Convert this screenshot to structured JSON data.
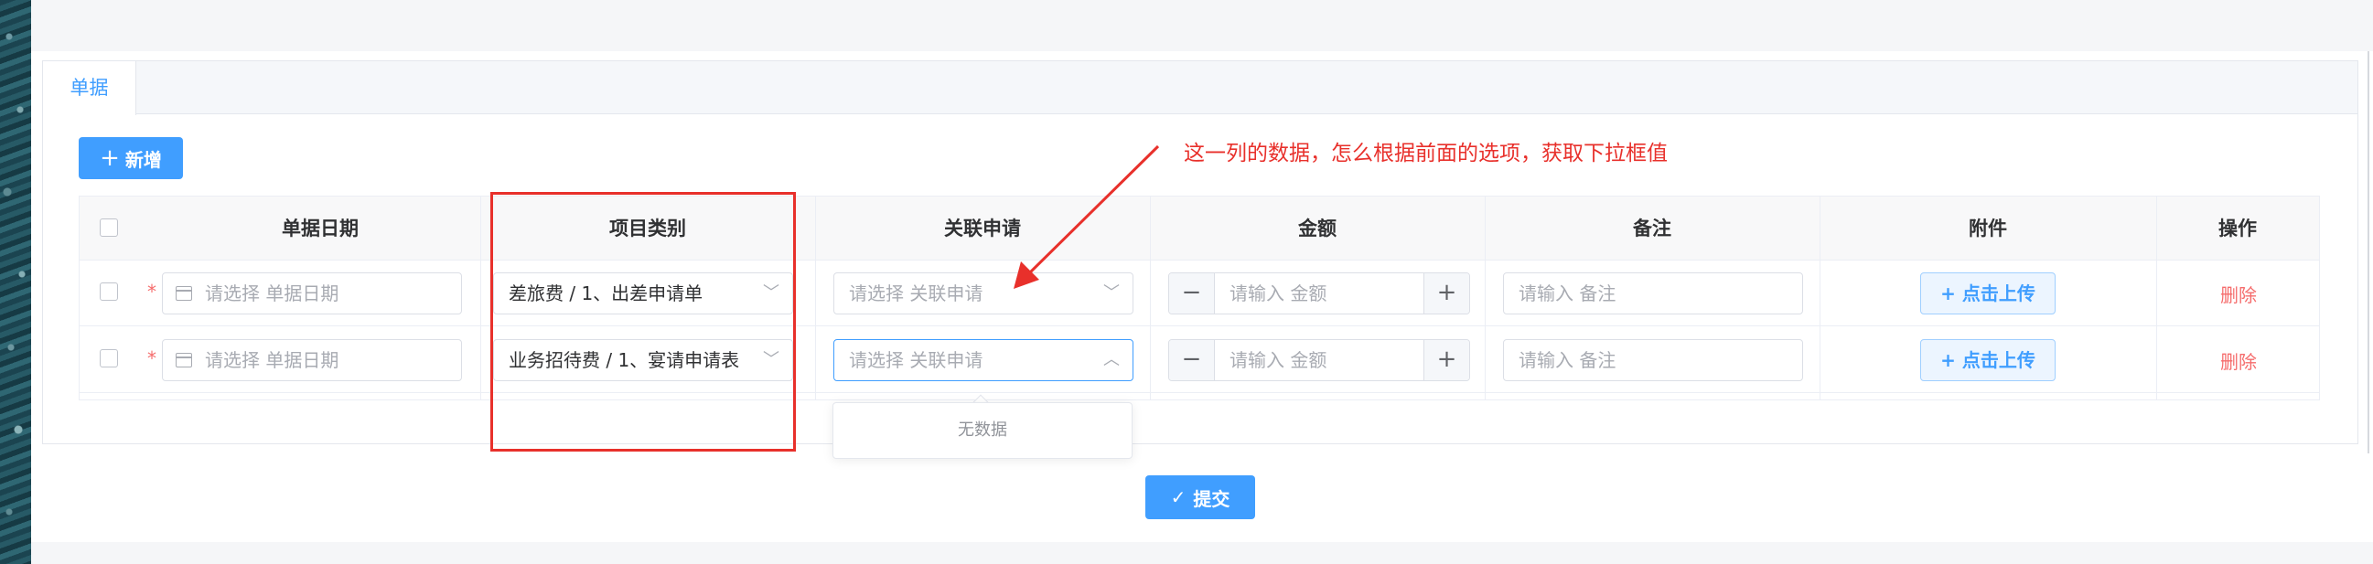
{
  "tabs": [
    {
      "label": "单据",
      "active": true
    }
  ],
  "toolbar": {
    "add_icon": "+",
    "add_label": "新增"
  },
  "table": {
    "columns": [
      "单据日期",
      "项目类别",
      "关联申请",
      "金额",
      "备注",
      "附件",
      "操作"
    ],
    "rows": [
      {
        "date_placeholder": "请选择 单据日期",
        "category": "差旅费 / 1、出差申请单",
        "related_placeholder": "请选择 关联申请",
        "amount_placeholder": "请输入 金额",
        "remark_placeholder": "请输入 备注",
        "upload_label": "+ 点击上传",
        "delete_label": "删除"
      },
      {
        "date_placeholder": "请选择 单据日期",
        "category": "业务招待费 / 1、宴请申请表",
        "related_placeholder": "请选择 关联申请",
        "amount_placeholder": "请输入 金额",
        "remark_placeholder": "请输入 备注",
        "upload_label": "+ 点击上传",
        "delete_label": "删除"
      }
    ]
  },
  "required_mark": "*",
  "stepper": {
    "minus": "−",
    "plus": "+"
  },
  "chevrons": {
    "down": "﹀",
    "up": "︿"
  },
  "dropdown": {
    "empty_text": "无数据"
  },
  "annotation": {
    "text": "这一列的数据，怎么根据前面的选项，获取下拉框值",
    "color": "#e8302b"
  },
  "submit": {
    "icon": "✓",
    "label": "提交"
  },
  "colors": {
    "primary": "#409eff",
    "danger": "#f56c6c",
    "annotation_red": "#e8302b"
  }
}
